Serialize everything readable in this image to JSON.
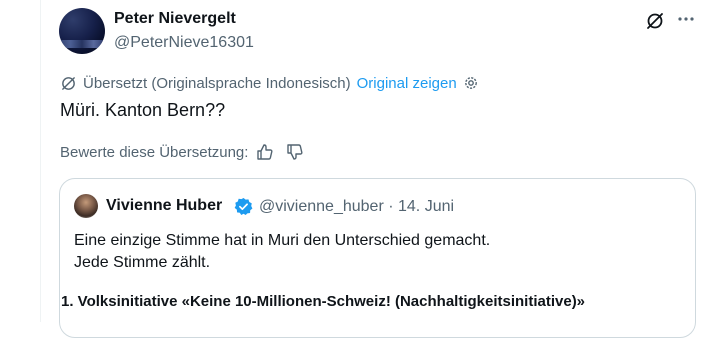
{
  "post": {
    "author_name": "Peter Nievergelt",
    "author_handle": "@PeterNieve16301",
    "translation_note": "Übersetzt (Originalsprache Indonesisch)",
    "show_original": "Original zeigen",
    "text": "Müri. Kanton Bern??",
    "rate_label": "Bewerte diese Übersetzung:"
  },
  "quote": {
    "author_name": "Vivienne Huber",
    "author_handle": "@vivienne_huber",
    "separator": "·",
    "date": "14. Juni",
    "line1": "Eine einzige Stimme hat in Muri den Unterschied gemacht.",
    "line2": "Jede Stimme zählt.",
    "heading": "1. Volksinitiative «Keine 10-Millionen-Schweiz! (Nachhaltigkeitsinitiative)»"
  },
  "icons": [
    "grok-icon",
    "more-icon",
    "translate-icon",
    "gear-icon",
    "thumbs-up-icon",
    "thumbs-down-icon",
    "verified-badge-icon"
  ],
  "colors": {
    "text": "#0f1419",
    "secondary": "#536471",
    "accent": "#1d9bf0",
    "border": "#cfd9de"
  }
}
